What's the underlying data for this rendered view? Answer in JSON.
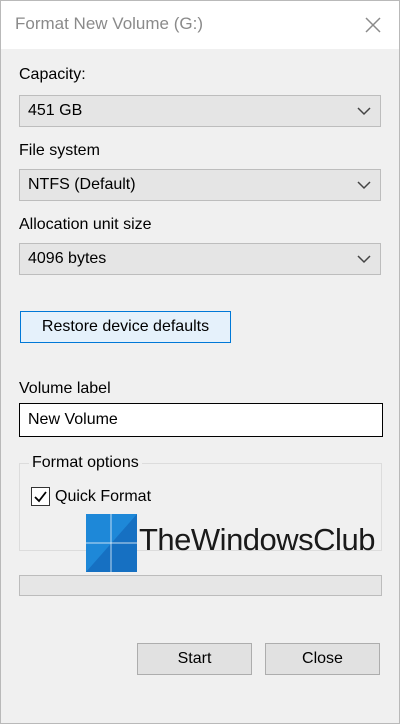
{
  "window": {
    "title": "Format New Volume (G:)"
  },
  "capacity": {
    "label": "Capacity:",
    "value": "451 GB"
  },
  "file_system": {
    "label": "File system",
    "value": "NTFS (Default)"
  },
  "allocation": {
    "label": "Allocation unit size",
    "value": "4096 bytes"
  },
  "restore_button": "Restore device defaults",
  "volume_label": {
    "label": "Volume label",
    "value": "New Volume"
  },
  "format_options": {
    "title": "Format options",
    "quick_format": {
      "label": "Quick Format",
      "checked": true
    }
  },
  "progress": {
    "value": 0
  },
  "watermark": {
    "text": "TheWindowsClub",
    "color": "#1e88d8"
  },
  "buttons": {
    "start": "Start",
    "close": "Close"
  },
  "colors": {
    "focus_border": "#0078d7",
    "title_text": "#8a8a8a"
  }
}
